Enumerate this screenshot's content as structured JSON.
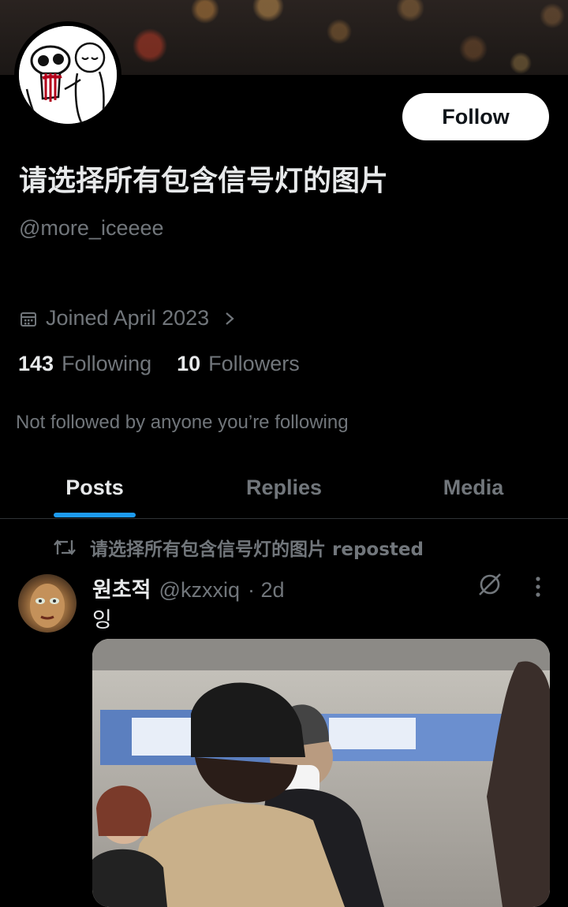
{
  "profile": {
    "display_name": "请选择所有包含信号灯的图片",
    "handle": "@more_iceeee",
    "follow_label": "Follow",
    "joined": "Joined April 2023",
    "following_count": "143",
    "following_label": "Following",
    "followers_count": "10",
    "followers_label": "Followers",
    "not_followed_text": "Not followed by anyone you’re following"
  },
  "tabs": [
    {
      "label": "Posts",
      "active": true
    },
    {
      "label": "Replies",
      "active": false
    },
    {
      "label": "Media",
      "active": false
    }
  ],
  "post": {
    "repost_text": "请选择所有包含信号灯的图片 reposted",
    "author": "원초적",
    "handle": "@kzxxiq",
    "time": "· 2d",
    "text": "잉"
  },
  "colors": {
    "accent": "#1d9bf0",
    "secondary_text": "#71767b",
    "primary_text": "#e7e9ea",
    "background": "#000000"
  },
  "icons": [
    "calendar-icon",
    "chevron-right-icon",
    "repost-icon",
    "grok-icon",
    "more-icon"
  ]
}
